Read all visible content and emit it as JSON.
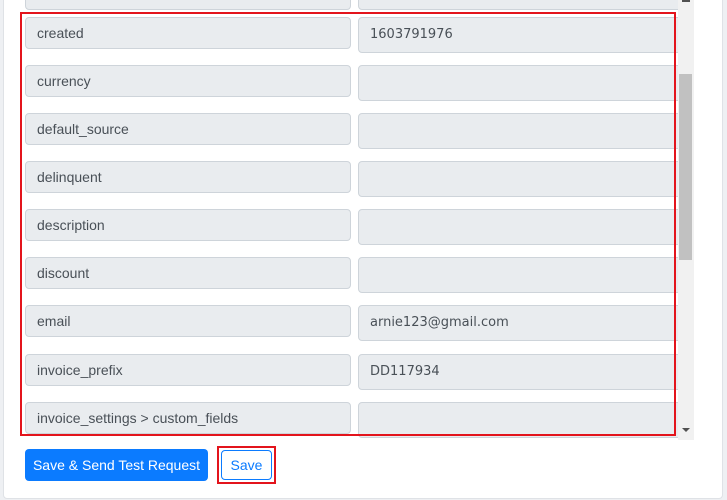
{
  "fields": [
    {
      "label": "created",
      "value": "1603791976"
    },
    {
      "label": "currency",
      "value": ""
    },
    {
      "label": "default_source",
      "value": ""
    },
    {
      "label": "delinquent",
      "value": ""
    },
    {
      "label": "description",
      "value": ""
    },
    {
      "label": "discount",
      "value": ""
    },
    {
      "label": "email",
      "value": "arnie123@gmail.com"
    },
    {
      "label": "invoice_prefix",
      "value": "DD117934"
    },
    {
      "label": "invoice_settings > custom_fields",
      "value": ""
    }
  ],
  "buttons": {
    "save_and_test": "Save & Send Test Request",
    "save": "Save"
  },
  "colors": {
    "accent": "#0b7bff",
    "highlight": "#e3141c",
    "field_bg": "#e9ecef"
  }
}
